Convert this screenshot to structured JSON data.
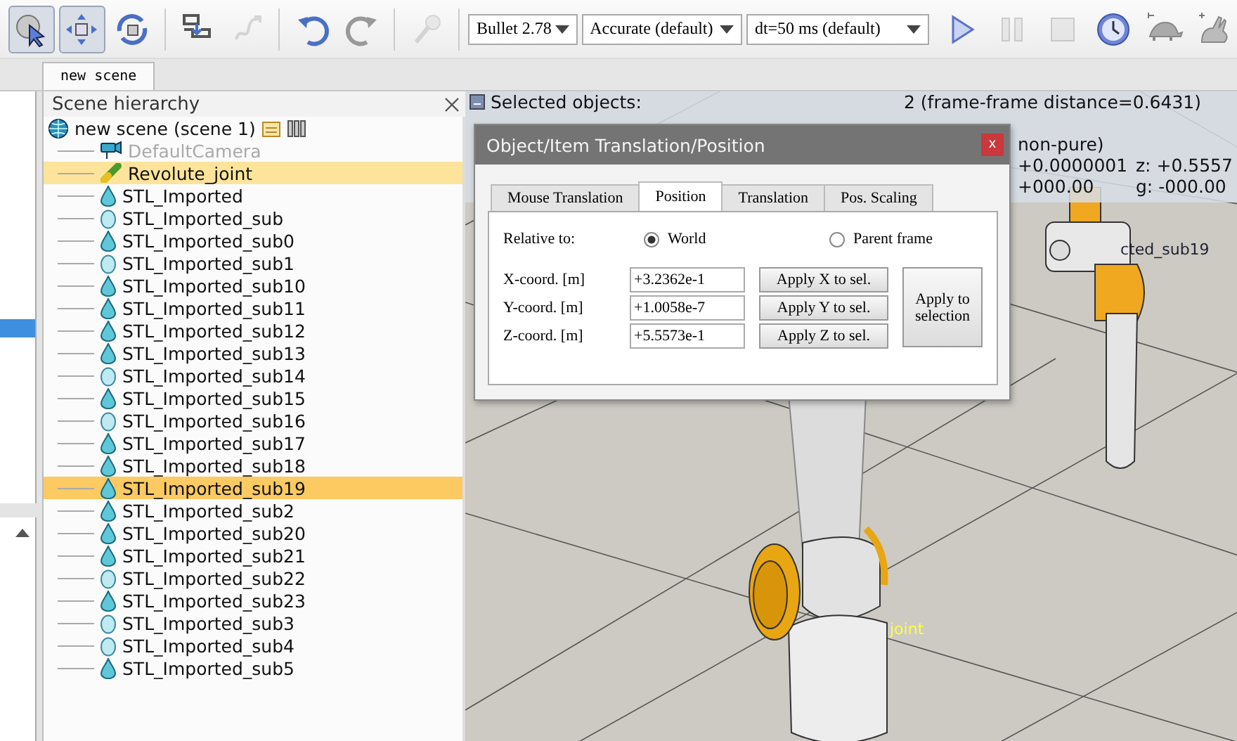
{
  "toolbar": {
    "tools_left": [
      {
        "selected": true,
        "disabled": false
      },
      {
        "selected": true,
        "disabled": false
      },
      {
        "selected": false,
        "disabled": false
      },
      {
        "selected": false,
        "disabled": false
      },
      {
        "selected": false,
        "disabled": true
      },
      {
        "selected": false,
        "disabled": false
      },
      {
        "selected": false,
        "disabled": false
      },
      {
        "selected": false,
        "disabled": true
      }
    ],
    "dropdowns": [
      {
        "value": "Bullet 2.78"
      },
      {
        "value": "Accurate (default)"
      },
      {
        "value": "dt=50 ms (default)"
      }
    ],
    "tools_right": [
      {
        "selected": false,
        "disabled": false
      },
      {
        "selected": false,
        "disabled": true
      },
      {
        "selected": false,
        "disabled": true
      },
      {
        "selected": false,
        "disabled": false
      },
      {
        "selected": false,
        "disabled": false
      },
      {
        "selected": false,
        "disabled": false
      }
    ]
  },
  "document_tabs": [
    {
      "label": "new scene",
      "selected": true
    }
  ],
  "scene_hierarchy": {
    "title": "Scene hierarchy",
    "root": {
      "label": "new scene (scene 1)",
      "children": [
        {
          "label": "DefaultCamera",
          "kind": "camera",
          "disabled": true,
          "selected": false,
          "last_selected": false
        },
        {
          "label": "Revolute_joint",
          "kind": "joint",
          "disabled": false,
          "selected": true,
          "last_selected": false
        },
        {
          "label": "STL_Imported",
          "kind": "drop",
          "disabled": false,
          "selected": false,
          "last_selected": false
        },
        {
          "label": "STL_Imported_sub",
          "kind": "egg",
          "disabled": false,
          "selected": false,
          "last_selected": false
        },
        {
          "label": "STL_Imported_sub0",
          "kind": "drop",
          "disabled": false,
          "selected": false,
          "last_selected": false
        },
        {
          "label": "STL_Imported_sub1",
          "kind": "egg",
          "disabled": false,
          "selected": false,
          "last_selected": false
        },
        {
          "label": "STL_Imported_sub10",
          "kind": "drop",
          "disabled": false,
          "selected": false,
          "last_selected": false
        },
        {
          "label": "STL_Imported_sub11",
          "kind": "drop",
          "disabled": false,
          "selected": false,
          "last_selected": false
        },
        {
          "label": "STL_Imported_sub12",
          "kind": "drop",
          "disabled": false,
          "selected": false,
          "last_selected": false
        },
        {
          "label": "STL_Imported_sub13",
          "kind": "drop",
          "disabled": false,
          "selected": false,
          "last_selected": false
        },
        {
          "label": "STL_Imported_sub14",
          "kind": "egg",
          "disabled": false,
          "selected": false,
          "last_selected": false
        },
        {
          "label": "STL_Imported_sub15",
          "kind": "drop",
          "disabled": false,
          "selected": false,
          "last_selected": false
        },
        {
          "label": "STL_Imported_sub16",
          "kind": "egg",
          "disabled": false,
          "selected": false,
          "last_selected": false
        },
        {
          "label": "STL_Imported_sub17",
          "kind": "drop",
          "disabled": false,
          "selected": false,
          "last_selected": false
        },
        {
          "label": "STL_Imported_sub18",
          "kind": "drop",
          "disabled": false,
          "selected": false,
          "last_selected": false
        },
        {
          "label": "STL_Imported_sub19",
          "kind": "drop",
          "disabled": false,
          "selected": true,
          "last_selected": true
        },
        {
          "label": "STL_Imported_sub2",
          "kind": "drop",
          "disabled": false,
          "selected": false,
          "last_selected": false
        },
        {
          "label": "STL_Imported_sub20",
          "kind": "drop",
          "disabled": false,
          "selected": false,
          "last_selected": false
        },
        {
          "label": "STL_Imported_sub21",
          "kind": "drop",
          "disabled": false,
          "selected": false,
          "last_selected": false
        },
        {
          "label": "STL_Imported_sub22",
          "kind": "egg",
          "disabled": false,
          "selected": false,
          "last_selected": false
        },
        {
          "label": "STL_Imported_sub23",
          "kind": "drop",
          "disabled": false,
          "selected": false,
          "last_selected": false
        },
        {
          "label": "STL_Imported_sub3",
          "kind": "egg",
          "disabled": false,
          "selected": false,
          "last_selected": false
        },
        {
          "label": "STL_Imported_sub4",
          "kind": "egg",
          "disabled": false,
          "selected": false,
          "last_selected": false
        },
        {
          "label": "STL_Imported_sub5",
          "kind": "drop",
          "disabled": false,
          "selected": false,
          "last_selected": false
        }
      ]
    }
  },
  "viewport": {
    "info": {
      "selected_label": "Selected objects:",
      "selected_value": "2 (frame-frame distance=0.6431)",
      "fragments": [
        {
          "text": "non-pure)"
        },
        {
          "text": "+0.0000001"
        },
        {
          "text": "z: +0.5557"
        },
        {
          "text": "+000.00"
        },
        {
          "text": "g: -000.00"
        }
      ]
    },
    "labels": [
      {
        "text": "cted_sub19",
        "kind": "dark"
      },
      {
        "text": "joint",
        "kind": "yellow"
      }
    ]
  },
  "dialog": {
    "title": "Object/Item Translation/Position",
    "close": "x",
    "tabs": [
      {
        "label": "Mouse Translation",
        "selected": false
      },
      {
        "label": "Position",
        "selected": true
      },
      {
        "label": "Translation",
        "selected": false
      },
      {
        "label": "Pos. Scaling",
        "selected": false
      }
    ],
    "relative_label": "Relative to:",
    "relative_options": [
      {
        "label": "World",
        "selected": true
      },
      {
        "label": "Parent frame",
        "selected": false
      }
    ],
    "coords": [
      {
        "label": "X-coord. [m]",
        "value": "+3.2362e-1",
        "button": "Apply X to sel."
      },
      {
        "label": "Y-coord. [m]",
        "value": "+1.0058e-7",
        "button": "Apply Y to sel."
      },
      {
        "label": "Z-coord. [m]",
        "value": "+5.5573e-1",
        "button": "Apply Z to sel."
      }
    ],
    "apply_all": "Apply to selection"
  }
}
